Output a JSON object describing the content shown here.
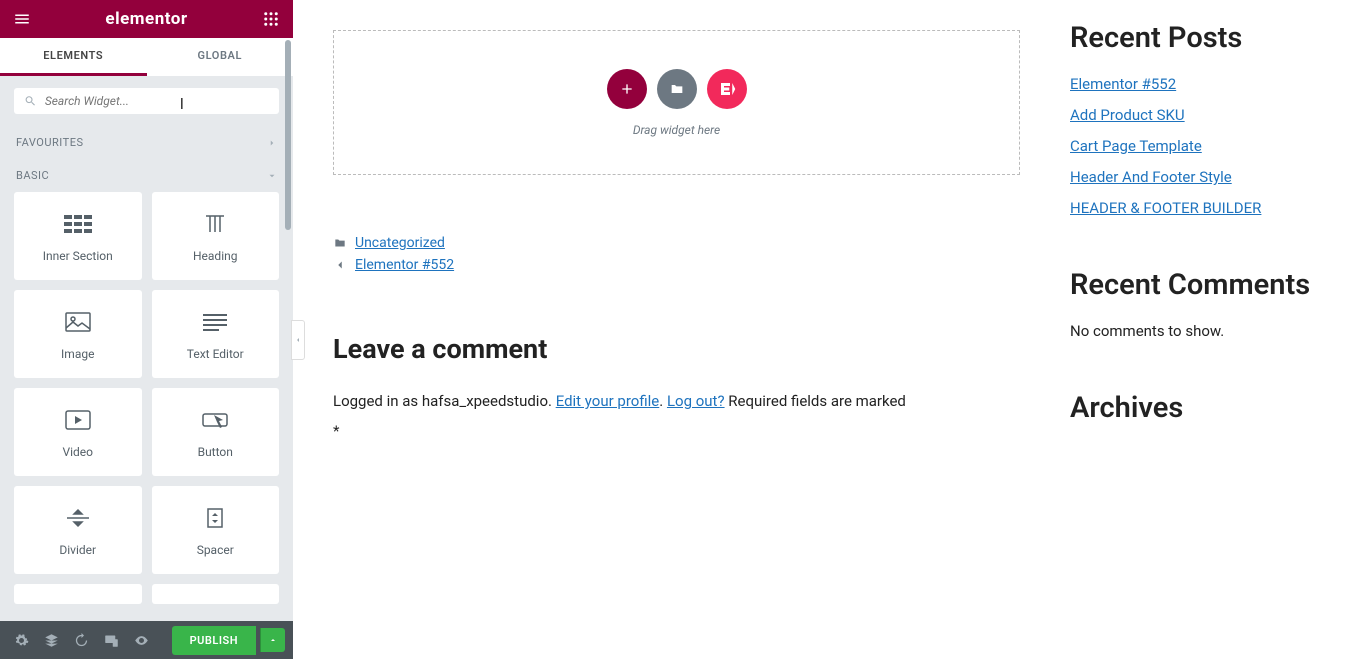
{
  "header": {
    "logo": "elementor"
  },
  "tabs": {
    "elements": "ELEMENTS",
    "global": "GLOBAL"
  },
  "search": {
    "placeholder": "Search Widget..."
  },
  "cats": {
    "fav": "FAVOURITES",
    "basic": "BASIC"
  },
  "widgets": {
    "inner_section": "Inner Section",
    "heading": "Heading",
    "image": "Image",
    "text_editor": "Text Editor",
    "video": "Video",
    "button": "Button",
    "divider": "Divider",
    "spacer": "Spacer"
  },
  "footer": {
    "publish": "PUBLISH"
  },
  "dropzone": {
    "text": "Drag widget here",
    "ek": "E<"
  },
  "meta": {
    "category": "Uncategorized",
    "breadcrumb": "Elementor #552"
  },
  "comment": {
    "heading": "Leave a comment",
    "logged_prefix": "Logged in as hafsa_xpeedstudio. ",
    "edit": "Edit your profile",
    "dot": ". ",
    "logout": "Log out?",
    "suffix": " Required fields are marked",
    "asterisk": "*"
  },
  "sidebar": {
    "recent_posts_h": "Recent Posts",
    "posts": [
      "Elementor #552",
      "Add Product SKU",
      "Cart Page Template",
      "Header And Footer Style",
      "HEADER & FOOTER BUILDER"
    ],
    "recent_comments_h": "Recent Comments",
    "no_comments": "No comments to show.",
    "archives_h": "Archives"
  }
}
